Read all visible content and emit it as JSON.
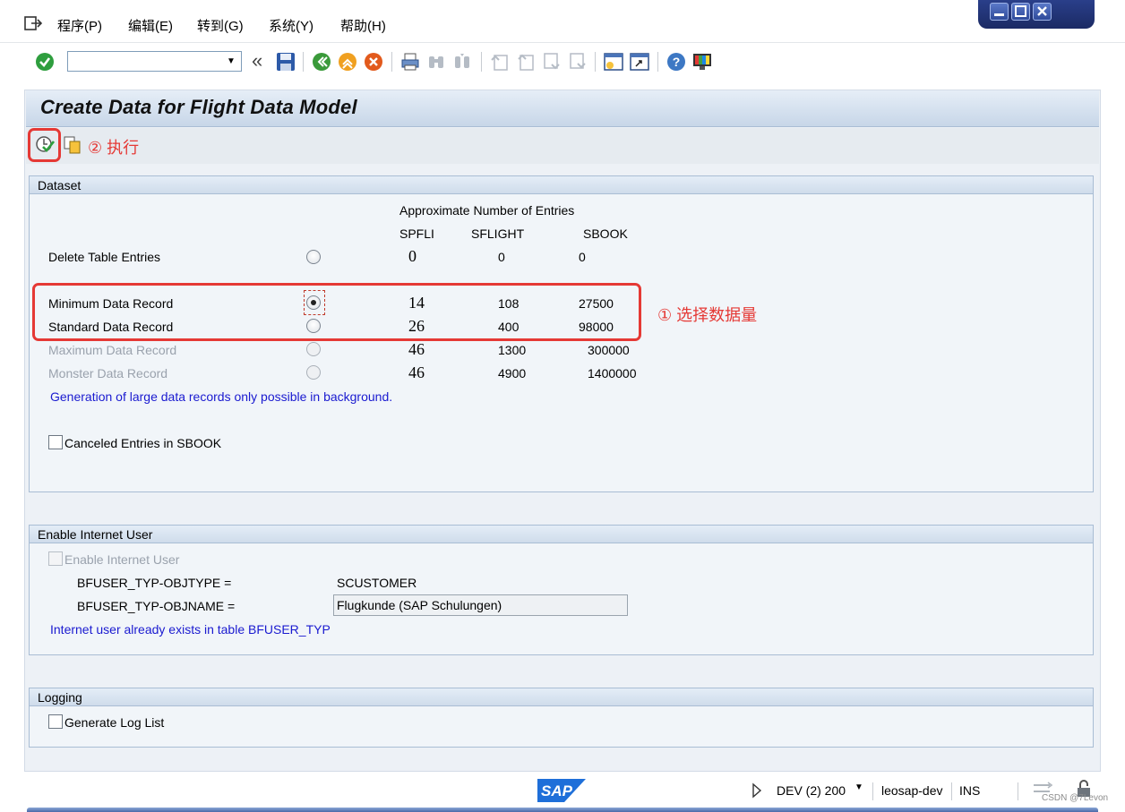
{
  "menu": {
    "items": [
      "程序(P)",
      "编辑(E)",
      "转到(G)",
      "系统(Y)",
      "帮助(H)"
    ]
  },
  "toolbar": {
    "command_value": "",
    "nav_back_glyph": "«",
    "icons": [
      "check-icon",
      "save-icon",
      "back-icon",
      "exit-icon",
      "cancel-icon",
      "print-icon",
      "find-icon",
      "find-next-icon",
      "first-page-icon",
      "previous-page-icon",
      "next-page-icon",
      "last-page-icon",
      "new-session-icon",
      "shortcut-icon",
      "help-icon",
      "customize-layout-icon"
    ]
  },
  "page": {
    "title": "Create Data for Flight Data Model"
  },
  "app_toolbar": {
    "icons": [
      "execute-icon",
      "copy-variant-icon"
    ]
  },
  "dataset": {
    "header": "Dataset",
    "entries_caption": "Approximate Number of Entries",
    "columns": [
      "SPFLI",
      "SFLIGHT",
      "SBOOK"
    ],
    "rows": [
      {
        "label": "Delete Table Entries",
        "spfli": "0",
        "sflight": "0",
        "sbook": "0",
        "selected": false,
        "enabled": true
      },
      {
        "label": "Minimum Data Record",
        "spfli": "14",
        "sflight": "108",
        "sbook": "27500",
        "selected": true,
        "enabled": true
      },
      {
        "label": "Standard Data Record",
        "spfli": "26",
        "sflight": "400",
        "sbook": "98000",
        "selected": false,
        "enabled": true
      },
      {
        "label": "Maximum Data Record",
        "spfli": "46",
        "sflight": "1300",
        "sbook": "300000",
        "selected": false,
        "enabled": false
      },
      {
        "label": "Monster Data Record",
        "spfli": "46",
        "sflight": "4900",
        "sbook": "1400000",
        "selected": false,
        "enabled": false
      }
    ],
    "note": "Generation of large data records only possible in background.",
    "canceled_entries_label": "Canceled Entries in SBOOK"
  },
  "internet_user": {
    "header": "Enable Internet User",
    "checkbox_label": "Enable Internet User",
    "objtype_label": "BFUSER_TYP-OBJTYPE =",
    "objtype_value": "SCUSTOMER",
    "objname_label": "BFUSER_TYP-OBJNAME =",
    "objname_value": "Flugkunde (SAP Schulungen)",
    "note": "Internet user already exists in table BFUSER_TYP"
  },
  "logging": {
    "header": "Logging",
    "checkbox_label": "Generate Log List"
  },
  "annotations": {
    "execute": "② 执行",
    "select_volume": "① 选择数据量"
  },
  "status": {
    "sap_logo": "SAP",
    "system": "DEV (2) 200",
    "server": "leosap-dev",
    "mode": "INS",
    "watermark": "CSDN @7Levon"
  },
  "colors": {
    "annotation": "#e53935",
    "info_text": "#1a1ad0",
    "title_bar": "#c7d6e8"
  }
}
